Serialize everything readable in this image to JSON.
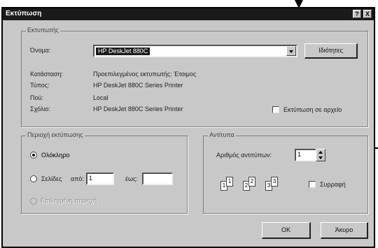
{
  "window": {
    "title": "Εκτύπωση",
    "help_label": "?",
    "close_label": "X"
  },
  "printer": {
    "legend": "Εκτυπωτής",
    "name_label": "Όνομα:",
    "name_value": "HP DeskJet 880C",
    "properties_label": "Ιδιότητες",
    "status_label": "Κατάσταση:",
    "status_value": "Προεπιλεγμένος εκτυπωτής: Έτοιμος",
    "type_label": "Τύπος:",
    "type_value": "HP DeskJet 880C Series Printer",
    "where_label": "Πού:",
    "where_value": "Local",
    "comment_label": "Σχόλιο:",
    "comment_value": "HP DeskJet 880C Series Printer",
    "print_to_file_label": "Εκτύπωση σε αρχείο"
  },
  "range": {
    "legend": "Περιοχή εκτύπωσης",
    "all_label": "Ολόκληρο",
    "pages_label": "Σελίδες",
    "from_label": "από:",
    "from_value": "1",
    "to_label": "έως:",
    "to_value": "",
    "selection_label": "Επιλεγμένη περιοχή"
  },
  "copies": {
    "legend": "Αντίτυπα",
    "number_label": "Αριθμός αντιτύπων:",
    "number_value": "1",
    "collate_label": "Συρραφή",
    "collate_pages": [
      "1",
      "1",
      "2",
      "2",
      "3",
      "3"
    ]
  },
  "buttons": {
    "ok_label": "OK",
    "cancel_label": "Άκυρο"
  }
}
